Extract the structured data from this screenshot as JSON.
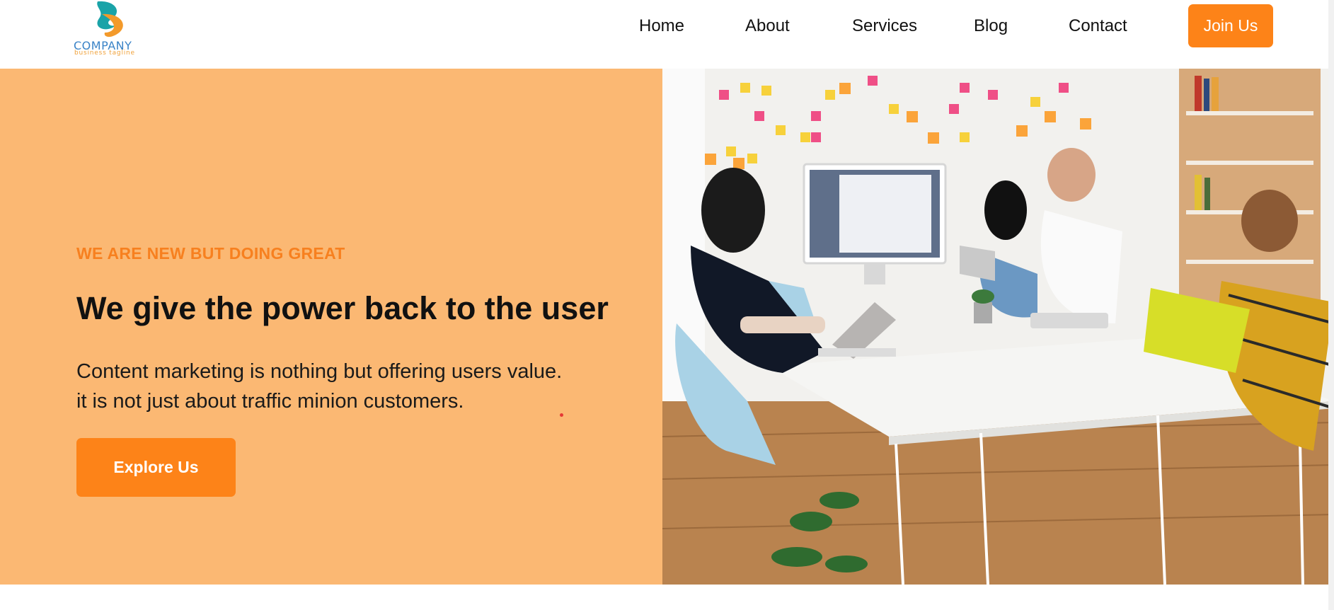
{
  "brand": {
    "name": "COMPANY",
    "tagline": "business tagline",
    "colors": {
      "accent": "#fd8318",
      "hero_bg": "#fbb873",
      "eyebrow": "#f7801f",
      "logo_blue": "#3a83c7",
      "logo_teal": "#1aa3a8",
      "logo_orange": "#f39a2b"
    }
  },
  "nav": {
    "items": [
      {
        "label": "Home"
      },
      {
        "label": "About"
      },
      {
        "label": "Services"
      },
      {
        "label": "Blog"
      },
      {
        "label": "Contact"
      }
    ],
    "cta_label": "Join Us"
  },
  "hero": {
    "eyebrow": "WE ARE NEW BUT DOING GREAT",
    "headline": "We give the power back to the user",
    "description_lines": [
      "Content marketing is nothing but offering users value.",
      "it is not just about traffic minion customers."
    ],
    "cta_label": "Explore Us",
    "image_icon": "team-meeting-photo"
  }
}
